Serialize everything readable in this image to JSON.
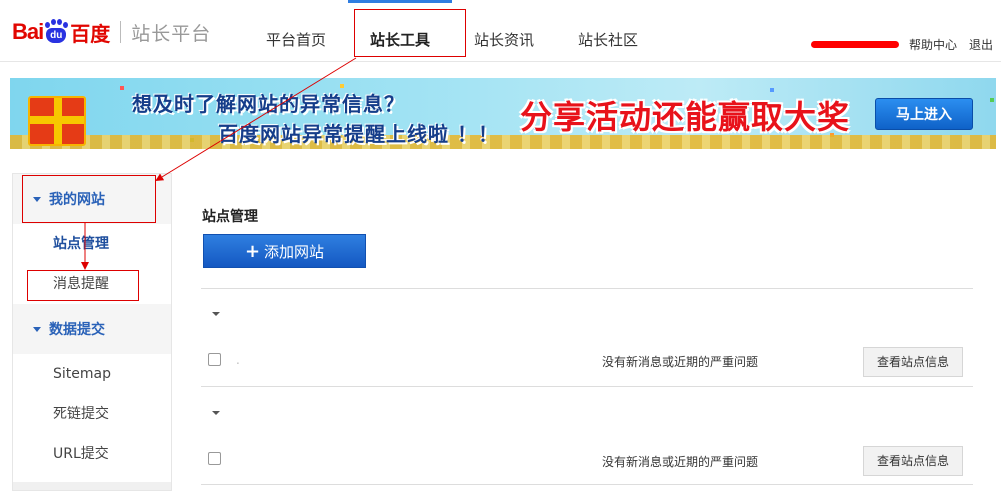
{
  "header": {
    "logo_latin": "Bai",
    "logo_paw": "du",
    "logo_cn": "百度",
    "platform": "站长平台",
    "nav": [
      "平台首页",
      "站长工具",
      "站长资讯",
      "站长社区"
    ],
    "help": "帮助中心",
    "logout": "退出"
  },
  "banner": {
    "line1": "想及时了解网站的异常信息？",
    "line2": "百度网站异常提醒上线啦 ！！",
    "big": "分享活动还能赢取大奖",
    "button": "马上进入"
  },
  "sidebar": {
    "group1": "我的网站",
    "items1": [
      "站点管理",
      "消息提醒"
    ],
    "group2": "数据提交",
    "items2": [
      "Sitemap",
      "死链提交",
      "URL提交"
    ]
  },
  "main": {
    "title": "站点管理",
    "add_button": "添加网站",
    "rows": [
      {
        "site": ".",
        "status": "没有新消息或近期的严重问题",
        "button": "查看站点信息"
      },
      {
        "site": "",
        "status": "没有新消息或近期的严重问题",
        "button": "查看站点信息"
      }
    ]
  },
  "colors": {
    "accent": "#2a62b8",
    "brand_red": "#e10601",
    "annotation_red": "#dd0000"
  }
}
